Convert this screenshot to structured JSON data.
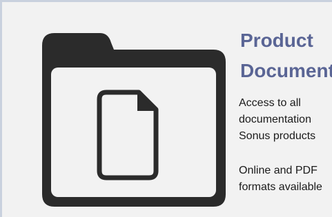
{
  "card": {
    "icon": "folder-with-document-icon",
    "title_line1": "Product",
    "title_line2": "Documentation",
    "description_lines": [
      "Access to all",
      "documentation",
      "Sonus products"
    ],
    "formats_lines": [
      "Online and PDF",
      "formats available"
    ]
  },
  "colors": {
    "title": "#5a6595",
    "icon": "#2b2b2b",
    "background": "#f2f2f2",
    "border": "#c9d1de"
  }
}
